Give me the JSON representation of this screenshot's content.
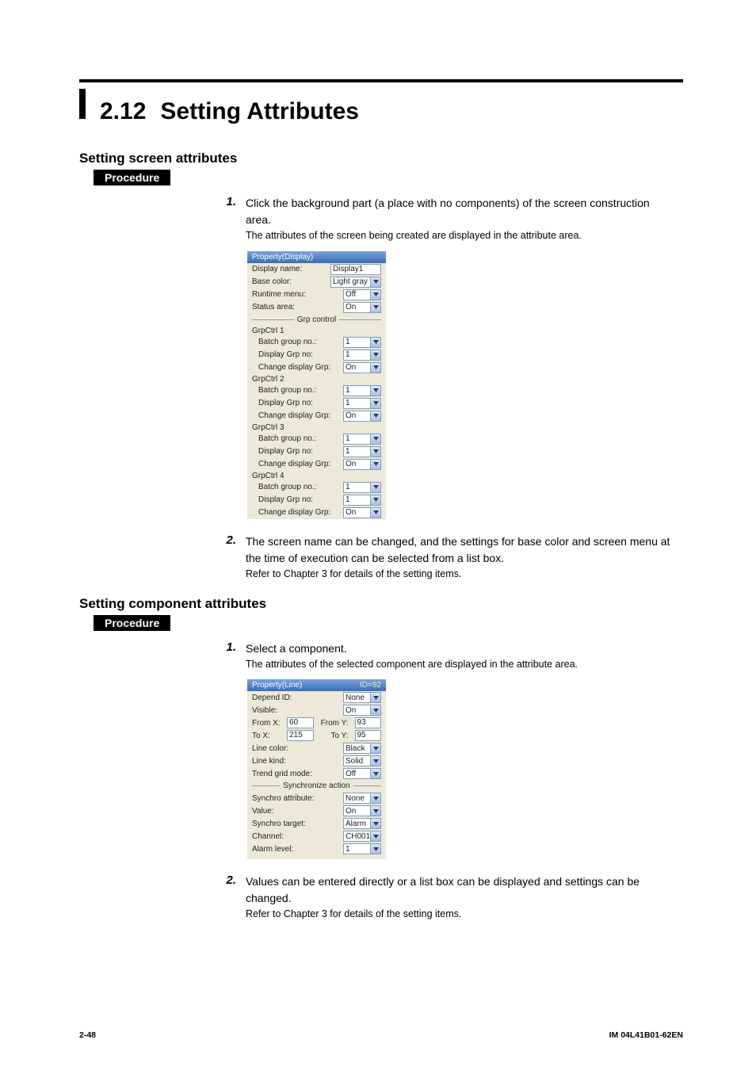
{
  "header": {
    "section_number": "2.12",
    "section_title": "Setting Attributes"
  },
  "s1": {
    "heading": "Setting screen attributes",
    "procedure_label": "Procedure",
    "step1_num": "1.",
    "step1_text": "Click the background part (a place with no components) of the screen construction area.",
    "step1_note": "The attributes of the screen being created are displayed in the attribute area.",
    "panel": {
      "title": "Property(Display)",
      "labels": {
        "display_name": "Display name:",
        "base_color": "Base color:",
        "runtime_menu": "Runtime menu:",
        "status_area": "Status area:",
        "grp_control": "Grp control",
        "batch_group_no": "Batch group no.:",
        "display_grp_no": "Display Grp no:",
        "change_display_grp": "Change display Grp:"
      },
      "grp_headers": {
        "g1": "GrpCtrl 1",
        "g2": "GrpCtrl 2",
        "g3": "GrpCtrl 3",
        "g4": "GrpCtrl 4"
      },
      "values": {
        "display_name": "Display1",
        "base_color": "Light gray",
        "runtime_menu": "Off",
        "status_area": "On",
        "batch_group_no": "1",
        "display_grp_no": "1",
        "change_display_grp": "On"
      }
    },
    "step2_num": "2.",
    "step2_text": "The screen name can be changed, and the settings for base color and screen menu at the time of execution can be selected from a list box.",
    "step2_note": "Refer to Chapter 3 for details of the setting items."
  },
  "s2": {
    "heading": "Setting component attributes",
    "procedure_label": "Procedure",
    "step1_num": "1.",
    "step1_text": "Select a component.",
    "step1_note": "The attributes of the selected component are displayed in the attribute area.",
    "panel": {
      "title_left": "Property(Line)",
      "title_right": "ID=92",
      "labels": {
        "depend_id": "Depend ID:",
        "visible": "Visible:",
        "from_x": "From X:",
        "from_y": "From Y:",
        "to_x": "To X:",
        "to_y": "To Y:",
        "line_color": "Line color:",
        "line_kind": "Line kind:",
        "trend_grid_mode": "Trend grid mode:",
        "sync_action": "Synchronize action",
        "synchro_attribute": "Synchro attribute:",
        "value": "Value:",
        "synchro_target": "Synchro target:",
        "channel": "Channel:",
        "alarm_level": "Alarm level:"
      },
      "values": {
        "depend_id": "None",
        "visible": "On",
        "from_x": "60",
        "from_y": "93",
        "to_x": "215",
        "to_y": "95",
        "line_color": "Black",
        "line_kind": "Solid",
        "trend_grid_mode": "Off",
        "synchro_attribute": "None",
        "value": "On",
        "synchro_target": "Alarm",
        "channel": "CH001",
        "alarm_level": "1"
      }
    },
    "step2_num": "2.",
    "step2_text": "Values can be entered directly or a list box can be displayed and settings can be changed.",
    "step2_note": "Refer to Chapter 3 for details of the setting items."
  },
  "footer": {
    "left": "2-48",
    "right": "IM 04L41B01-62EN"
  }
}
